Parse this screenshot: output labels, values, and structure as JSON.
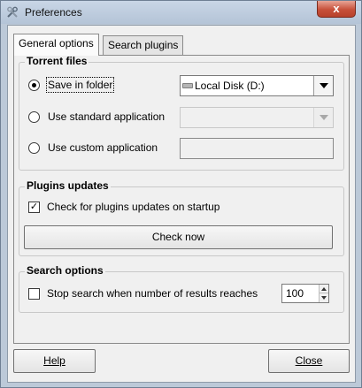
{
  "window": {
    "title": "Preferences",
    "close_label": "x"
  },
  "tabs": [
    {
      "label": "General options",
      "active": true
    },
    {
      "label": "Search plugins",
      "active": false
    }
  ],
  "torrent_files": {
    "title": "Torrent files",
    "options": [
      {
        "label": "Save in folder",
        "checked": true
      },
      {
        "label": "Use standard application",
        "checked": false
      },
      {
        "label": "Use custom application",
        "checked": false
      }
    ],
    "folder_combo_value": "Local Disk (D:)",
    "standard_app_combo_value": "",
    "custom_app_value": ""
  },
  "plugins_updates": {
    "title": "Plugins updates",
    "check_label": "Check for plugins updates on startup",
    "check_checked": true,
    "check_now_label": "Check now"
  },
  "search_options": {
    "title": "Search options",
    "stop_label": "Stop search when number of results reaches",
    "stop_checked": false,
    "results_limit": "100"
  },
  "footer": {
    "help_label": "Help",
    "close_label": "Close"
  },
  "icons": {
    "app": "tools-icon",
    "drive": "drive-icon",
    "cursor": "mouse-pointer-icon"
  }
}
